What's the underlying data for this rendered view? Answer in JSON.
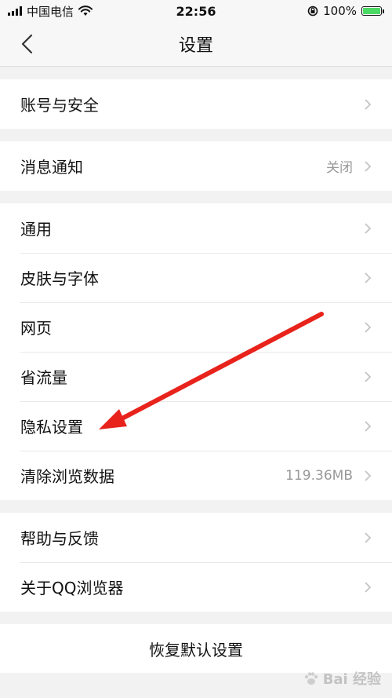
{
  "status_bar": {
    "carrier": "中国电信",
    "time": "22:56",
    "battery": "100%",
    "battery_level": 1.0
  },
  "nav": {
    "title": "设置"
  },
  "groups": [
    {
      "items": [
        {
          "label": "账号与安全",
          "value": ""
        }
      ]
    },
    {
      "items": [
        {
          "label": "消息通知",
          "value": "关闭"
        }
      ]
    },
    {
      "items": [
        {
          "label": "通用",
          "value": ""
        },
        {
          "label": "皮肤与字体",
          "value": ""
        },
        {
          "label": "网页",
          "value": ""
        },
        {
          "label": "省流量",
          "value": ""
        },
        {
          "label": "隐私设置",
          "value": ""
        },
        {
          "label": "清除浏览数据",
          "value": "119.36MB"
        }
      ]
    },
    {
      "items": [
        {
          "label": "帮助与反馈",
          "value": ""
        },
        {
          "label": "关于QQ浏览器",
          "value": ""
        }
      ]
    }
  ],
  "restore": {
    "label": "恢复默认设置"
  },
  "annotation": {
    "arrow_color": "#e8231c"
  },
  "watermark": {
    "text": "Bai 经验"
  }
}
